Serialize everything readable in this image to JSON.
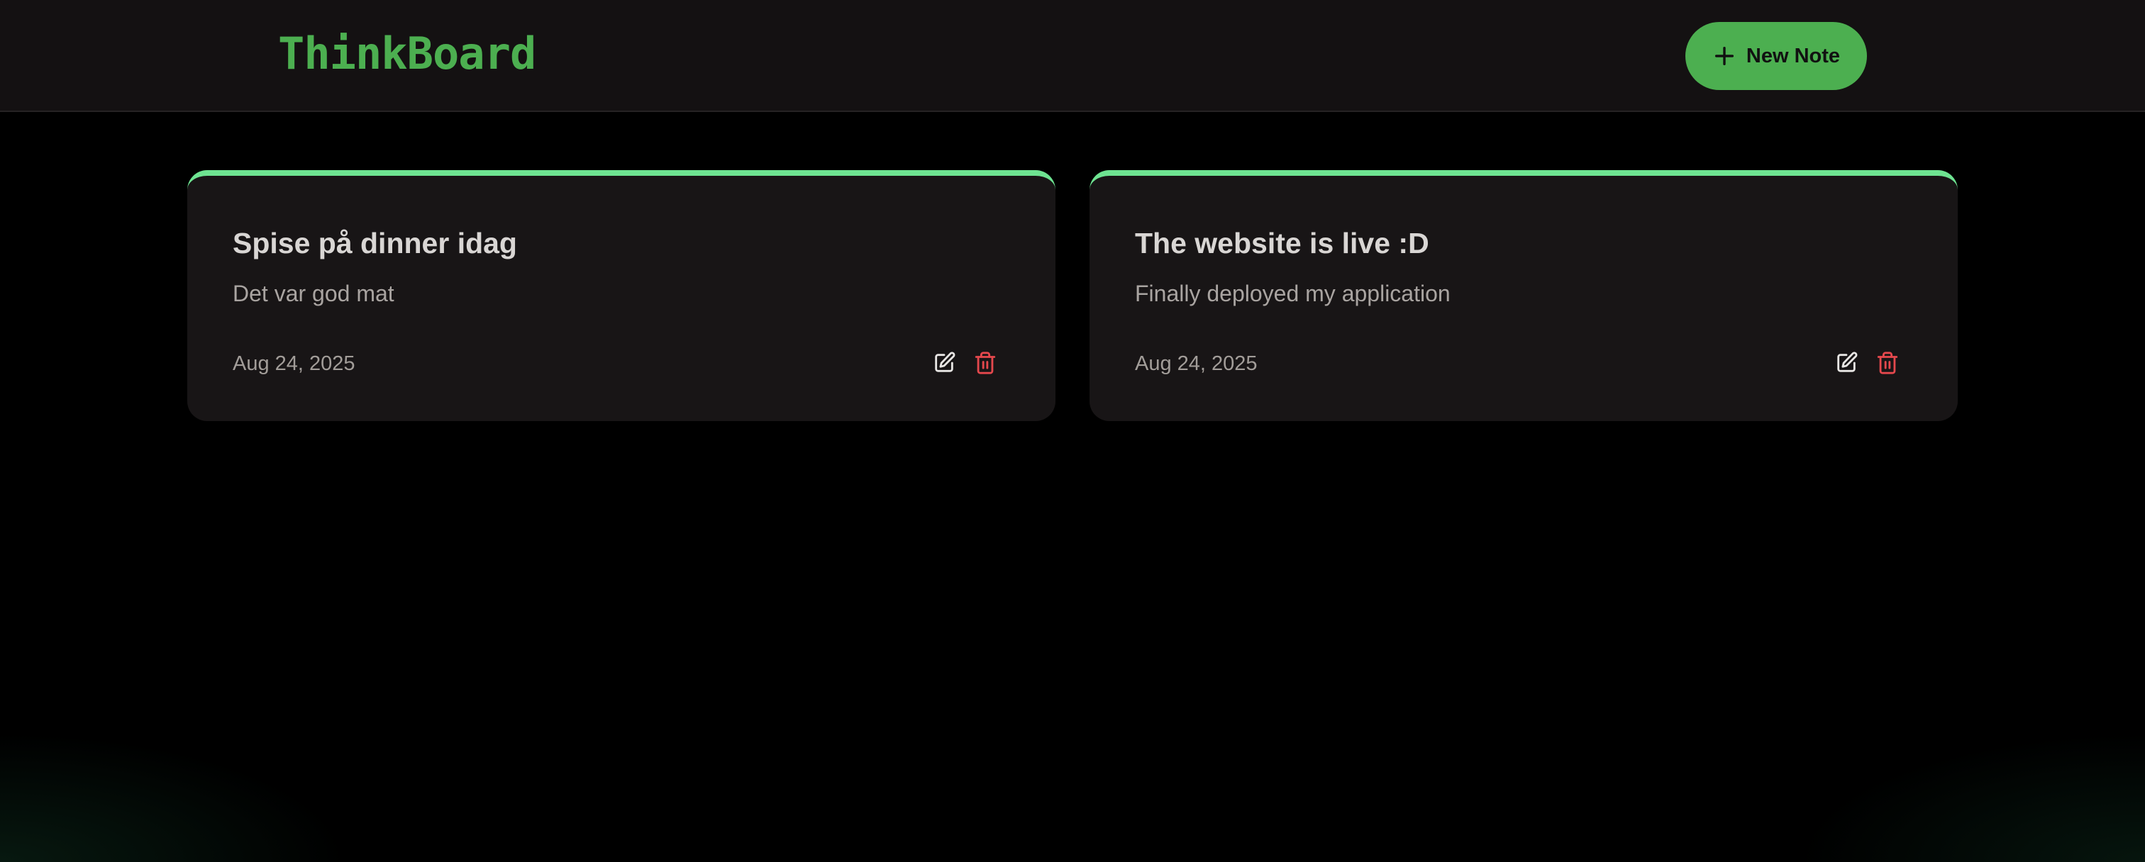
{
  "app": {
    "title": "ThinkBoard"
  },
  "header": {
    "new_note_label": "New Note",
    "new_note_icon": "plus-icon"
  },
  "notes": [
    {
      "title": "Spise på dinner idag",
      "content": "Det var god mat",
      "date": "Aug 24, 2025",
      "edit_icon": "edit-icon",
      "delete_icon": "trash-icon"
    },
    {
      "title": "The website is live :D",
      "content": "Finally deployed my application",
      "date": "Aug 24, 2025",
      "edit_icon": "edit-icon",
      "delete_icon": "trash-icon"
    }
  ],
  "colors": {
    "accent": "#4caf50",
    "card_border": "#6ee391",
    "delete": "#e5484d",
    "background": "#000000",
    "header_bg": "#141112",
    "card_bg": "#181516"
  }
}
